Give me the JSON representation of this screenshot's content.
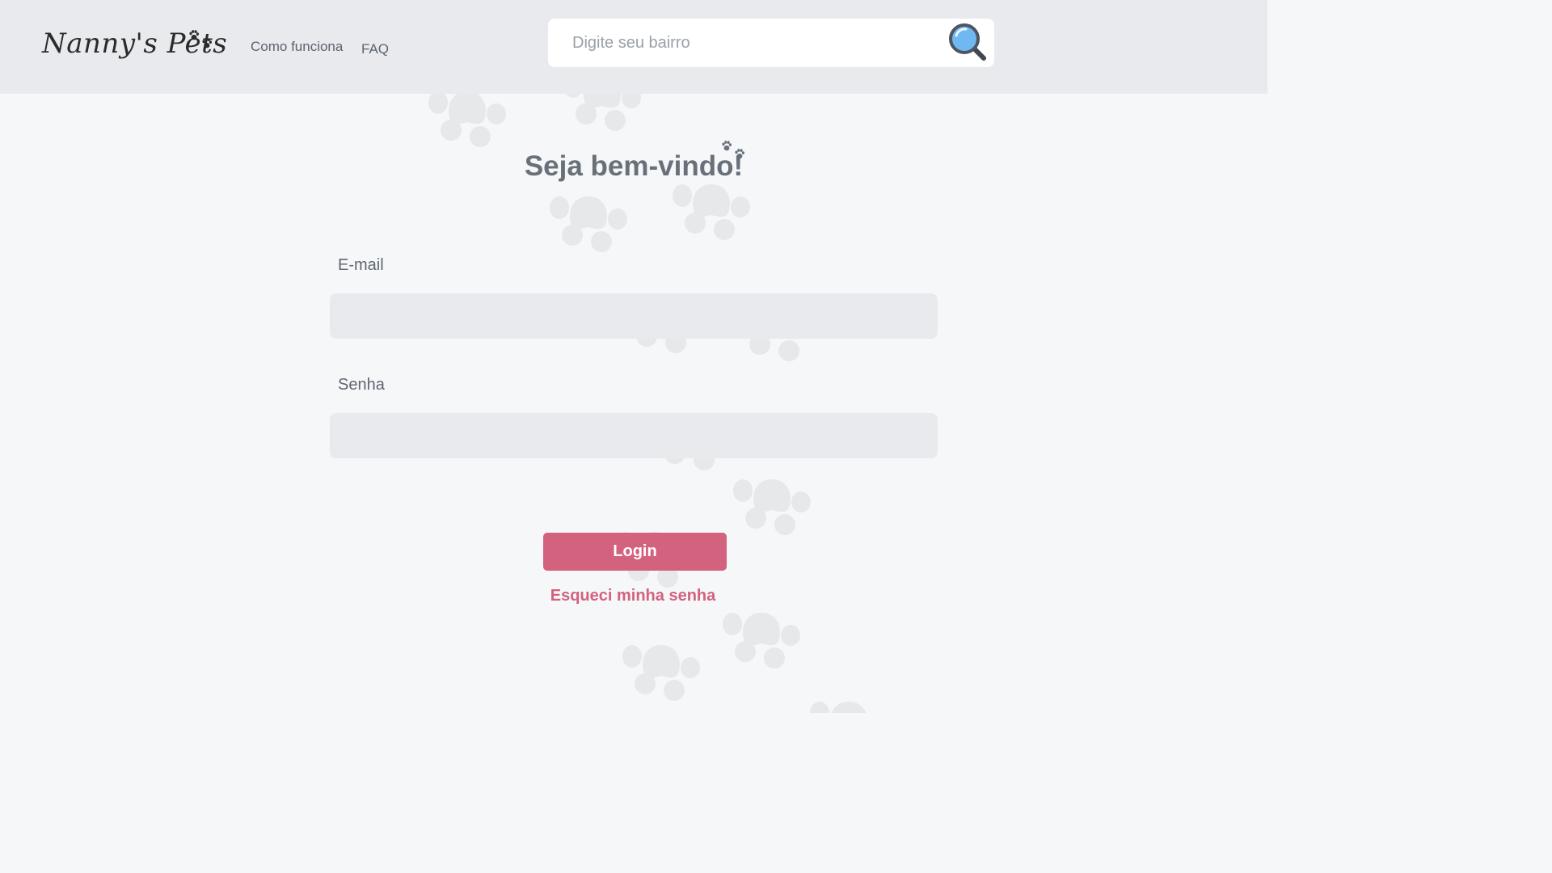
{
  "header": {
    "logo_text": "Nanny's Pets",
    "nav": {
      "como_funciona": "Como funciona",
      "faq": "FAQ"
    },
    "search": {
      "placeholder": "Digite seu bairro",
      "value": "",
      "icon": "magnifying-glass-icon"
    }
  },
  "main": {
    "title": "Seja bem-vindo!",
    "email_label": "E-mail",
    "email_value": "",
    "password_label": "Senha",
    "password_value": "",
    "login_label": "Login",
    "forgot_label": "Esqueci minha senha"
  },
  "colors": {
    "header_bg": "#e8eaed",
    "page_bg": "#f6f7f9",
    "accent": "#d3627e",
    "field_bg": "#e8eaed",
    "paw_bg": "#e6e8ea"
  }
}
